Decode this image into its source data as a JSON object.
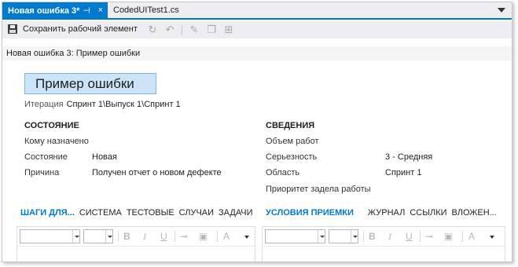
{
  "tabs": {
    "active": {
      "label": "Новая ошибка 3*",
      "pin": "⊣",
      "close": "×"
    },
    "inactive": {
      "label": "CodedUITest1.cs"
    }
  },
  "toolbar": {
    "save_label": "Сохранить рабочий элемент"
  },
  "titlebar": {
    "text": "Новая ошибка 3: Пример ошибки"
  },
  "work_item": {
    "title": "Пример ошибки",
    "iteration_label": "Итерация",
    "iteration_value": "Спринт 1\\Выпуск 1\\Спринт 1"
  },
  "status": {
    "heading": "СОСТОЯНИЕ",
    "assigned_to_label": "Кому назначено",
    "state_label": "Состояние",
    "state_value": "Новая",
    "reason_label": "Причина",
    "reason_value": "Получен отчет о новом дефекте"
  },
  "details": {
    "heading": "СВЕДЕНИЯ",
    "effort_label": "Объем работ",
    "severity_label": "Серьезность",
    "severity_value": "3 - Средняя",
    "area_label": "Область",
    "area_value": "Спринт 1",
    "backlog_priority_label": "Приоритет задела работы"
  },
  "left_tabs": [
    "ШАГИ ДЛЯ...",
    "СИСТЕМА",
    "ТЕСТОВЫЕ",
    "СЛУЧАИ",
    "ЗАДАЧИ"
  ],
  "right_tabs": [
    "УСЛОВИЯ ПРИЕМКИ",
    "ЖУРНАЛ",
    "ССЫЛКИ",
    "ВЛОЖЕН..."
  ],
  "editor": {
    "bold": "B",
    "italic": "I",
    "underline": "U",
    "font_color": "A"
  }
}
